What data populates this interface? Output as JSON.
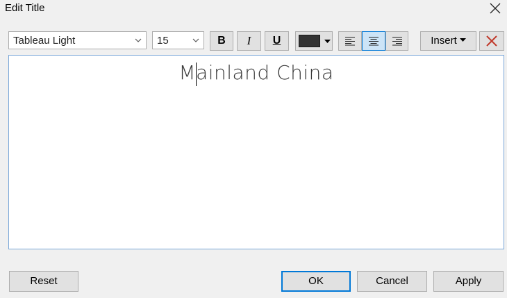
{
  "window": {
    "title": "Edit Title"
  },
  "toolbar": {
    "font_value": "Tableau Light",
    "size_value": "15",
    "bold_label": "B",
    "italic_label": "I",
    "underline_label": "U",
    "text_color": "#333333",
    "alignment_selected": "center",
    "insert_label": "Insert"
  },
  "editor": {
    "text": "Mainland China"
  },
  "footer": {
    "reset_label": "Reset",
    "ok_label": "OK",
    "cancel_label": "Cancel",
    "apply_label": "Apply"
  },
  "colors": {
    "accent": "#0078d7",
    "clear_icon": "#c0392b",
    "dialog_bg": "#f0f0f0"
  },
  "icons": {
    "close": "close-icon",
    "font_dropdown": "chevron-down-icon",
    "size_dropdown": "chevron-down-icon",
    "color_dropdown": "caret-down-icon",
    "align_left": "align-left-icon",
    "align_center": "align-center-icon",
    "align_right": "align-right-icon",
    "insert_dropdown": "caret-down-icon",
    "clear": "clear-x-icon"
  }
}
